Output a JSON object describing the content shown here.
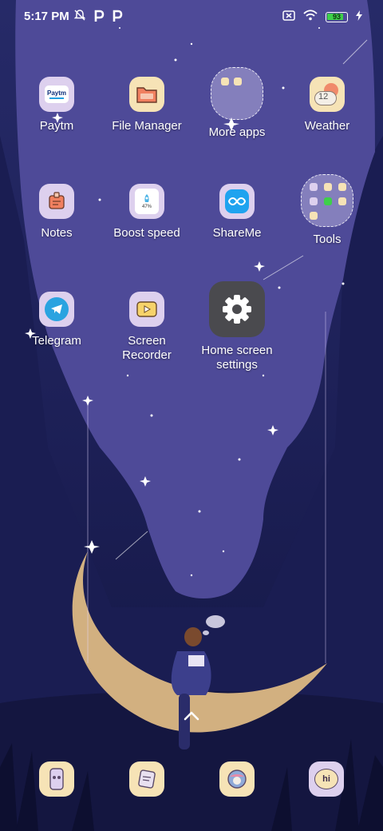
{
  "status_bar": {
    "time": "5:17 PM",
    "battery": "93",
    "battery_level": 0.93,
    "icons_left": [
      "muted-bell-icon",
      "paytm-p-icon",
      "paytm-p-icon"
    ],
    "icons_right": [
      "no-sim-icon",
      "wifi-icon",
      "battery-icon",
      "charging-bolt-icon"
    ]
  },
  "apps": [
    {
      "name": "paytm",
      "label": "Paytm",
      "icon": "paytm-icon",
      "icon_text": "Paytm"
    },
    {
      "name": "file-manager",
      "label": "File Manager",
      "icon": "folder-icon"
    },
    {
      "name": "more-apps",
      "label": "More apps",
      "icon": "folder-icon"
    },
    {
      "name": "weather",
      "label": "Weather",
      "icon": "weather-icon",
      "icon_text": "12"
    },
    {
      "name": "notes",
      "label": "Notes",
      "icon": "notes-icon"
    },
    {
      "name": "boost-speed",
      "label": "Boost speed",
      "icon": "rocket-icon",
      "icon_text": "47%"
    },
    {
      "name": "shareme",
      "label": "ShareMe",
      "icon": "infinity-icon"
    },
    {
      "name": "tools",
      "label": "Tools",
      "icon": "folder-icon"
    },
    {
      "name": "telegram",
      "label": "Telegram",
      "icon": "telegram-icon"
    },
    {
      "name": "screen-recorder",
      "label": "Screen\nRecorder",
      "icon": "screen-recorder-icon"
    },
    {
      "name": "home-screen-settings",
      "label": "Home screen\nsettings",
      "icon": "gear-icon"
    }
  ],
  "dock": [
    {
      "name": "phone",
      "icon": "phone-icon"
    },
    {
      "name": "messages",
      "icon": "messages-icon"
    },
    {
      "name": "browser",
      "icon": "browser-icon"
    },
    {
      "name": "chat",
      "icon": "chat-icon",
      "icon_text": "hi"
    }
  ],
  "colors": {
    "icon_cream": "#f6e3b6",
    "icon_lavender": "#ddd0ee",
    "sky": "#4e4a98",
    "moon": "#d2b080",
    "battery_fill": "#3ecf4a",
    "settings_bg": "#4a4a4e"
  }
}
